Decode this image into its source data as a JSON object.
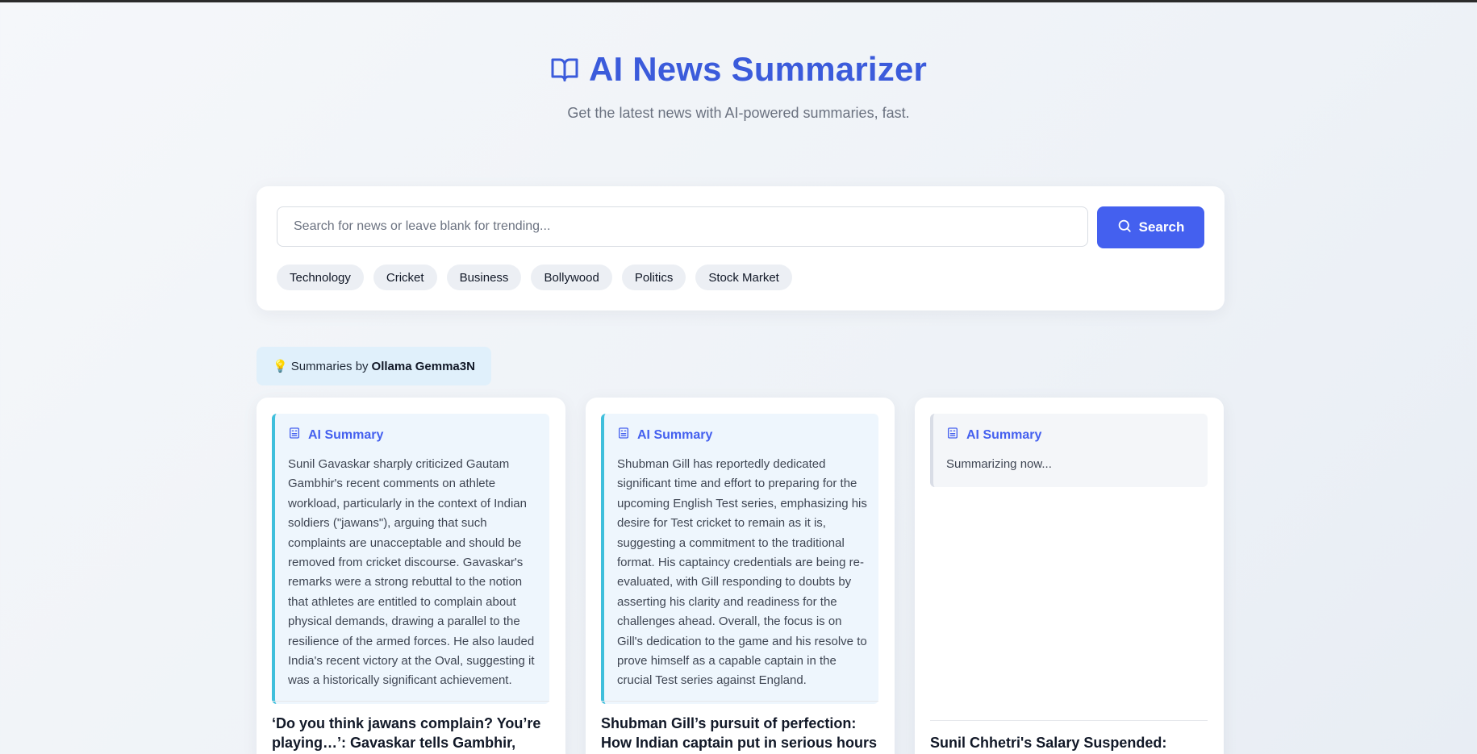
{
  "header": {
    "title": "AI News Summarizer",
    "subtitle": "Get the latest news with AI-powered summaries, fast.",
    "icon": "open-book-icon"
  },
  "search": {
    "placeholder": "Search for news or leave blank for trending...",
    "value": "",
    "button_label": "Search",
    "button_icon": "search-icon"
  },
  "categories": [
    "Technology",
    "Cricket",
    "Business",
    "Bollywood",
    "Politics",
    "Stock Market"
  ],
  "model_badge": {
    "icon": "💡",
    "prefix": "Summaries by",
    "model": "Ollama Gemma3N"
  },
  "cards": [
    {
      "summary_label": "AI Summary",
      "summary": "Sunil Gavaskar sharply criticized Gautam Gambhir's recent comments on athlete workload, particularly in the context of Indian soldiers (\"jawans\"), arguing that such complaints are unacceptable and should be removed from cricket discourse. Gavaskar's remarks were a strong rebuttal to the notion that athletes are entitled to complain about physical demands, drawing a parallel to the resilience of the armed forces. He also lauded India's recent victory at the Oval, suggesting it was a historically significant achievement.",
      "headline": "‘Do you think jawans complain? You’re playing…’: Gavaskar tells Gambhir,"
    },
    {
      "summary_label": "AI Summary",
      "summary": "Shubman Gill has reportedly dedicated significant time and effort to preparing for the upcoming English Test series, emphasizing his desire for Test cricket to remain as it is, suggesting a commitment to the traditional format. His captaincy credentials are being re-evaluated, with Gill responding to doubts by asserting his clarity and readiness for the challenges ahead. Overall, the focus is on Gill's dedication to the game and his resolve to prove himself as a capable captain in the crucial Test series against England.",
      "headline": "Shubman Gill’s pursuit of perfection: How Indian captain put in serious hours"
    },
    {
      "summary_label": "AI Summary",
      "summary": "Summarizing now...",
      "headline": "Sunil Chhetri's Salary Suspended:"
    }
  ],
  "colors": {
    "accent": "#4460ef",
    "title": "#3b5bdb",
    "summary_border": "#3fbfdc",
    "summary_bg": "#eef6fd",
    "badge_bg": "#e0f0fb"
  }
}
